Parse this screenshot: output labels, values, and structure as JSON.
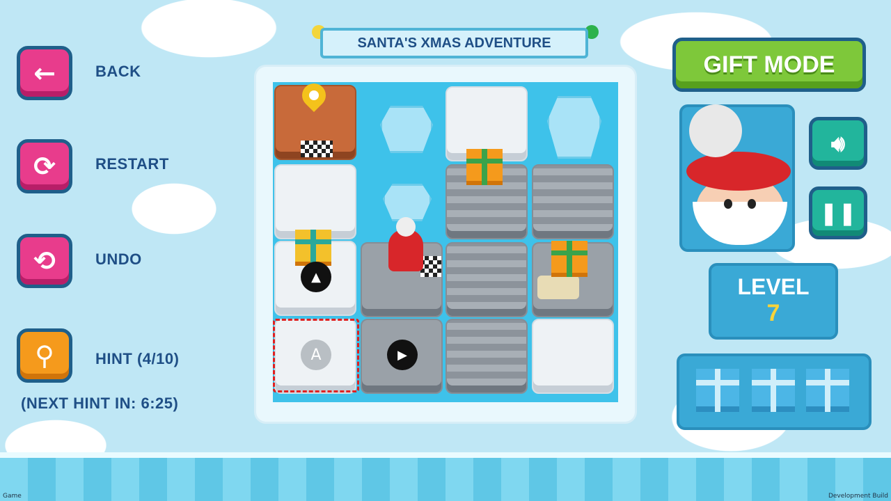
{
  "title": "SANTA'S XMAS ADVENTURE",
  "menu": {
    "back": "BACK",
    "restart": "RESTART",
    "undo": "UNDO",
    "hint": "HINT (4/10)",
    "next_hint": "(NEXT HINT IN: 6:25)"
  },
  "right": {
    "mode_button": "GIFT MODE",
    "level_label": "LEVEL",
    "level_value": "7",
    "gifts_total": 3
  },
  "board": {
    "markers": {
      "up": "▲",
      "play": "▶",
      "start": "A"
    }
  },
  "icons": {
    "back": "arrow-left-icon",
    "restart": "restart-icon",
    "undo": "undo-icon",
    "hint": "magnifier-icon",
    "sound": "speaker-icon",
    "pause": "pause-icon"
  },
  "colors": {
    "pink_button": "#e83c8c",
    "orange_button": "#f59a1c",
    "green_button": "#7ec83a",
    "teal_button": "#22b59c",
    "panel_blue": "#3aa9d6",
    "text_navy": "#1f4f86"
  },
  "footer": {
    "left": "Game",
    "right": "Development Build"
  }
}
